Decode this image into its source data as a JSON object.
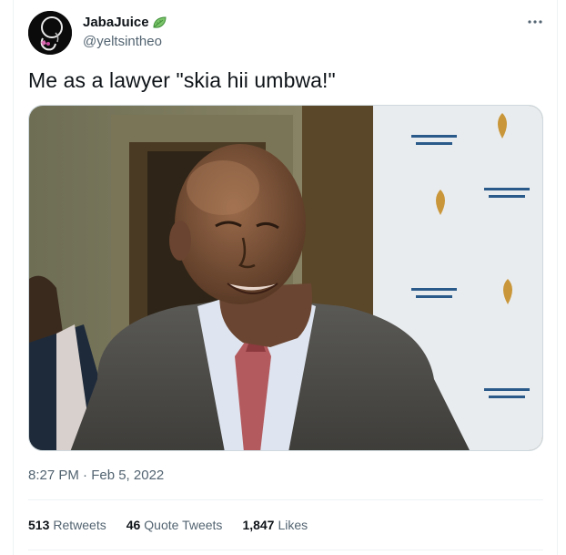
{
  "author": {
    "display_name": "JabaJuice",
    "handle": "@yeltsintheo",
    "badge_icon": "leaf-icon"
  },
  "tweet": {
    "text": "Me as a lawyer \"skia hii umbwa!\"",
    "timestamp": "8:27 PM · Feb 5, 2022"
  },
  "stats": {
    "retweets_count": "513",
    "retweets_label": "Retweets",
    "quote_count": "46",
    "quote_label": "Quote Tweets",
    "likes_count": "1,847",
    "likes_label": "Likes"
  },
  "colors": {
    "text_primary": "#0f1419",
    "text_secondary": "#536471",
    "divider": "#eff3f4",
    "leaf_green": "#4caf50"
  }
}
